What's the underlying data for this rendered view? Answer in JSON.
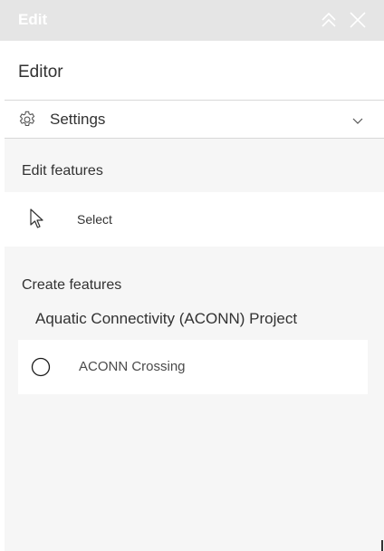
{
  "titlebar": {
    "title": "Edit",
    "collapse_icon": "double-chevron-up-icon",
    "close_icon": "close-icon"
  },
  "editor": {
    "heading": "Editor"
  },
  "settings": {
    "label": "Settings",
    "icon": "gear-icon",
    "expand_icon": "chevron-down-icon"
  },
  "edit_features": {
    "heading": "Edit features",
    "select": {
      "label": "Select",
      "icon": "cursor-arrow-icon"
    }
  },
  "create_features": {
    "heading": "Create features",
    "layer_name": "Aquatic Connectivity (ACONN) Project",
    "templates": [
      {
        "label": "ACONN Crossing",
        "icon": "circle-point-icon"
      }
    ]
  },
  "colors": {
    "titlebar_bg": "#e5e5e5",
    "panel_bg": "#ffffff",
    "content_bg": "#f6f6f6",
    "text": "#323232",
    "divider": "#d8d8d8"
  }
}
